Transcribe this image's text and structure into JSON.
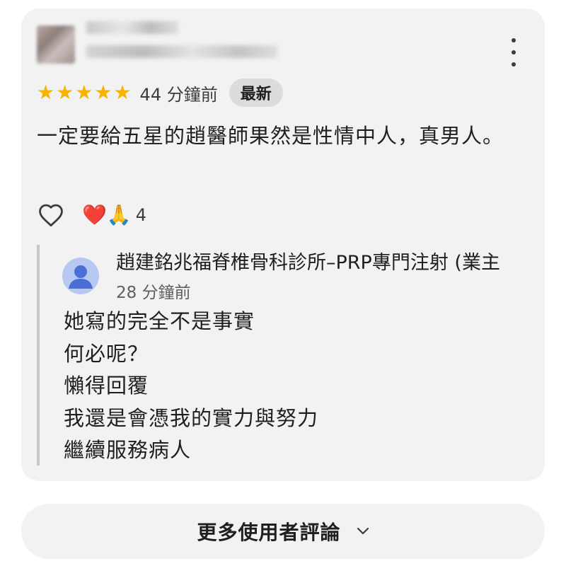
{
  "review": {
    "rating": 5,
    "max_rating": 5,
    "time_ago": "44 分鐘前",
    "badge": "最新",
    "text": "一定要給五星的趙醫師果然是性情中人，真男人。",
    "reaction_emoji": "❤️🙏",
    "reaction_count": "4"
  },
  "owner_reply": {
    "name": "趙建銘兆福脊椎骨科診所–PRP專門注射 (業主",
    "time_ago": "28 分鐘前",
    "lines": [
      "她寫的完全不是事實",
      "何必呢？",
      "懶得回覆",
      "我還是會憑我的實力與努力",
      "繼續服務病人"
    ]
  },
  "footer": {
    "more_reviews_label": "更多使用者評論"
  },
  "icons": {
    "star": "star-icon",
    "like": "heart-outline-icon",
    "menu": "more-vert-icon",
    "avatar": "person-icon",
    "expand": "chevron-down-icon"
  },
  "colors": {
    "star": "#f4b400",
    "card_bg": "#f2f2f2",
    "badge_bg": "#dcdcdc",
    "owner_avatar_bg": "#b7c9f3",
    "owner_avatar_fg": "#4a6fd4"
  }
}
